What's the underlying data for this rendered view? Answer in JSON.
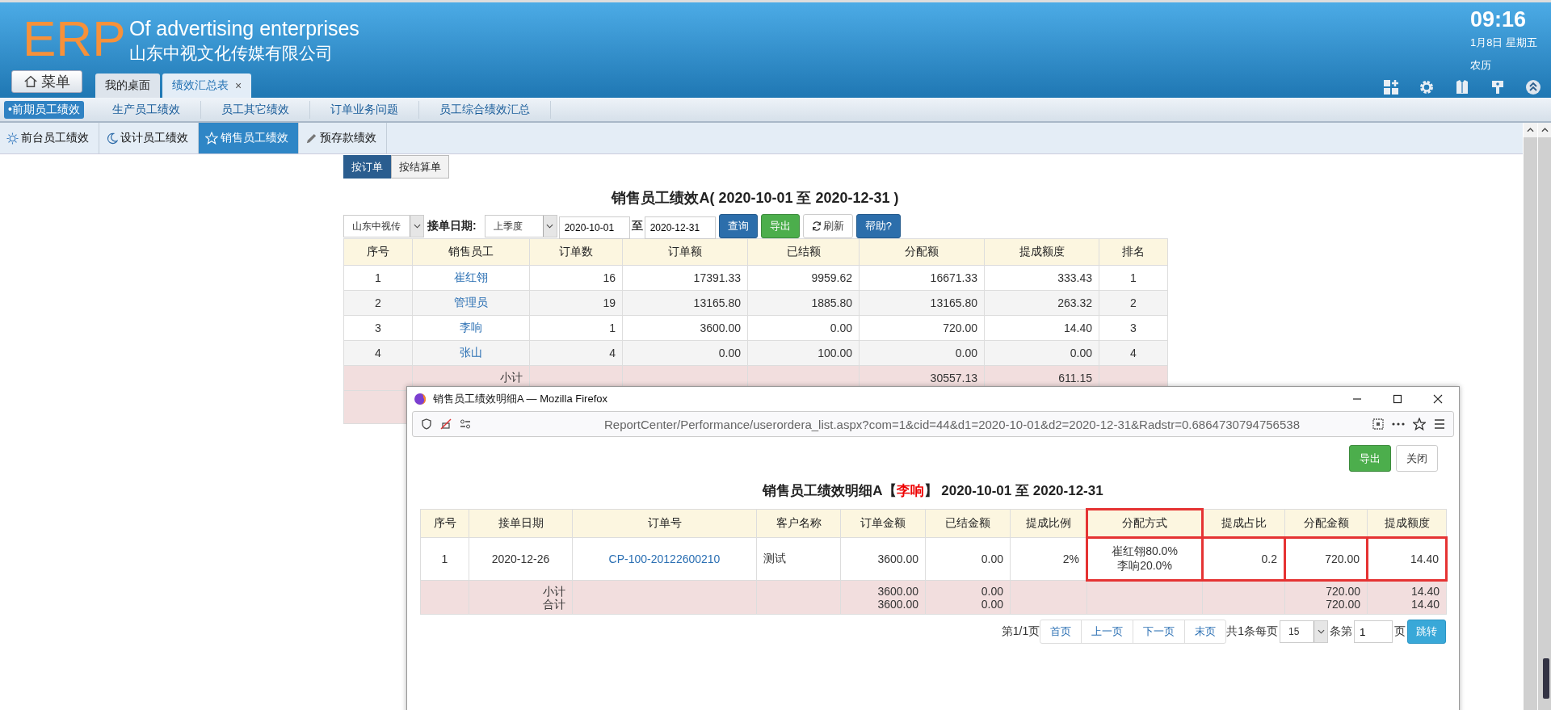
{
  "header": {
    "logo": "ERP",
    "slogan": "Of advertising enterprises",
    "company": "山东中视文化传媒有限公司",
    "menu_button": "菜单",
    "tabs": [
      {
        "label": "我的桌面",
        "selected": false
      },
      {
        "label": "绩效汇总表",
        "selected": true,
        "close": "×"
      }
    ],
    "clock": {
      "time": "09:16",
      "date": "1月8日 星期五",
      "lunar": "农历"
    },
    "toolbar": [
      {
        "kind": "add-tile"
      },
      {
        "kind": "gear"
      },
      {
        "kind": "shirt"
      },
      {
        "kind": "key"
      },
      {
        "kind": "collapse"
      }
    ]
  },
  "nav": [
    {
      "label": "•前期员工绩效",
      "selected": true
    },
    {
      "label": "生产员工绩效",
      "selected": false
    },
    {
      "label": "员工其它绩效",
      "selected": false
    },
    {
      "label": "订单业务问题",
      "selected": false
    },
    {
      "label": "员工综合绩效汇总",
      "selected": false
    }
  ],
  "subtabs": [
    {
      "label": "前台员工绩效",
      "kind": "sun",
      "selected": false
    },
    {
      "label": "设计员工绩效",
      "kind": "moon",
      "selected": false
    },
    {
      "label": "销售员工绩效",
      "kind": "star",
      "selected": true
    },
    {
      "label": "预存款绩效",
      "kind": "pencil",
      "selected": false
    }
  ],
  "mode_buttons": [
    {
      "label": "按订单",
      "selected": true
    },
    {
      "label": "按结算单",
      "selected": false
    }
  ],
  "report": {
    "title": "销售员工绩效A( 2020-10-01 至 2020-12-31 )",
    "filters": {
      "company": "山东中视传",
      "date_label": "接单日期:",
      "period": "上季度",
      "date_from": "2020-10-01",
      "to_label": "至",
      "date_to": "2020-12-31",
      "buttons": [
        {
          "label": "查询",
          "kind": "primary"
        },
        {
          "label": "导出",
          "kind": "success"
        },
        {
          "label": "刷新",
          "kind": "refresh"
        },
        {
          "label": "帮助?",
          "kind": "primary"
        }
      ]
    },
    "columns": [
      {
        "label": "序号",
        "kind": "center"
      },
      {
        "label": "销售员工",
        "kind": "link"
      },
      {
        "label": "订单数",
        "kind": "number"
      },
      {
        "label": "订单额",
        "kind": "number"
      },
      {
        "label": "已结额",
        "kind": "number"
      },
      {
        "label": "分配额",
        "kind": "number"
      },
      {
        "label": "提成额度",
        "kind": "number"
      },
      {
        "label": "排名",
        "kind": "center"
      }
    ],
    "rows": [
      {
        "cells": [
          "1",
          "崔红翎",
          "16",
          "17391.33",
          "9959.62",
          "16671.33",
          "333.43",
          "1"
        ]
      },
      {
        "cells": [
          "2",
          "管理员",
          "19",
          "13165.80",
          "1885.80",
          "13165.80",
          "263.32",
          "2"
        ]
      },
      {
        "cells": [
          "3",
          "李响",
          "1",
          "3600.00",
          "0.00",
          "720.00",
          "14.40",
          "3"
        ]
      },
      {
        "cells": [
          "4",
          "张山",
          "4",
          "0.00",
          "100.00",
          "0.00",
          "0.00",
          "4"
        ]
      }
    ],
    "subtotal": {
      "label": "小计",
      "allocated": "30557.13",
      "commission": "611.15"
    }
  },
  "popup": {
    "title": "销售员工绩效明细A — Mozilla Firefox",
    "url": "ReportCenter/Performance/userordera_list.aspx?com=1&cid=44&d1=2020-10-01&d2=2020-12-31&Radstr=0.6864730794756538",
    "buttons": [
      {
        "label": "导出",
        "kind": "success"
      },
      {
        "label": "关闭",
        "kind": "default"
      }
    ],
    "heading": {
      "before": "销售员工绩效明细A【",
      "name": "李响",
      "after": "】 2020-10-01 至 2020-12-31"
    },
    "columns": [
      {
        "label": "序号",
        "kind": "center",
        "highlighted": false
      },
      {
        "label": "接单日期",
        "kind": "center",
        "highlighted": false
      },
      {
        "label": "订单号",
        "kind": "link",
        "highlighted": false
      },
      {
        "label": "客户名称",
        "kind": "text",
        "highlighted": false
      },
      {
        "label": "订单金额",
        "kind": "number",
        "highlighted": false
      },
      {
        "label": "已结金额",
        "kind": "number",
        "highlighted": false
      },
      {
        "label": "提成比例",
        "kind": "number",
        "highlighted": false
      },
      {
        "label": "分配方式",
        "kind": "center",
        "highlighted": true
      },
      {
        "label": "提成占比",
        "kind": "number",
        "highlighted": false
      },
      {
        "label": "分配金额",
        "kind": "number",
        "highlighted": false
      },
      {
        "label": "提成额度",
        "kind": "number",
        "highlighted": false
      }
    ],
    "rows": [
      {
        "cells": [
          {
            "text": "1",
            "highlighted": false
          },
          {
            "text": "2020-12-26",
            "highlighted": false
          },
          {
            "text": "CP-100-20122600210",
            "highlighted": false
          },
          {
            "text": "测试",
            "highlighted": false
          },
          {
            "text": "3600.00",
            "highlighted": false
          },
          {
            "text": "0.00",
            "highlighted": false
          },
          {
            "text": "2%",
            "highlighted": false
          },
          {
            "lines": [
              "崔红翎80.0%",
              "李响20.0%"
            ],
            "highlighted": true
          },
          {
            "text": "0.2",
            "highlighted": true
          },
          {
            "text": "720.00",
            "highlighted": true
          },
          {
            "text": "14.40",
            "highlighted": true
          }
        ]
      }
    ],
    "totals": [
      {
        "label": "小计",
        "order_amount": "3600.00",
        "settled": "0.00",
        "allocated": "720.00",
        "commission": "14.40"
      },
      {
        "label": "合计",
        "order_amount": "3600.00",
        "settled": "0.00",
        "allocated": "720.00",
        "commission": "14.40"
      }
    ],
    "pagination": {
      "page_info": "第1/1页",
      "links": [
        "首页",
        "上一页",
        "下一页",
        "末页"
      ],
      "total": "共1条每页",
      "page_size": "15",
      "item_label": "条第",
      "page": "1",
      "page_suffix": "页",
      "go": "跳转"
    }
  }
}
